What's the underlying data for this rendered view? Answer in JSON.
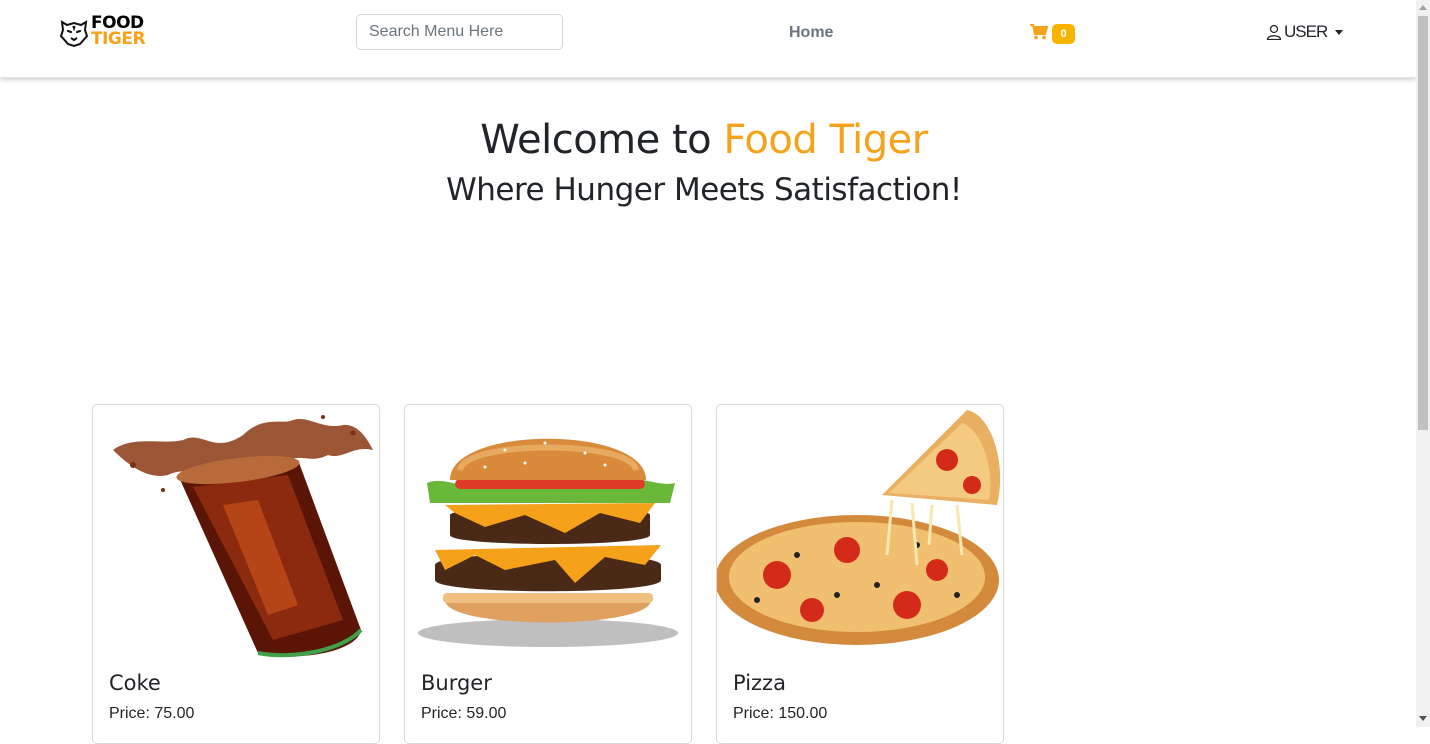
{
  "brand": {
    "line1": "FOOD",
    "line2": "TIGER"
  },
  "search": {
    "placeholder": "Search Menu Here"
  },
  "nav": {
    "home": "Home",
    "cart_count": "0",
    "user": "USER"
  },
  "hero": {
    "title_prefix": "Welcome to ",
    "title_accent": "Food Tiger",
    "subtitle": "Where Hunger Meets Satisfaction!"
  },
  "menu": [
    {
      "name": "Coke",
      "price": "Price: 75.00",
      "image": "coke-glass-splash"
    },
    {
      "name": "Burger",
      "price": "Price: 59.00",
      "image": "double-cheeseburger"
    },
    {
      "name": "Pizza",
      "price": "Price: 150.00",
      "image": "pepperoni-pizza"
    }
  ],
  "colors": {
    "accent": "#f7a21b",
    "badge": "#f7b500",
    "text": "#212529",
    "muted": "#6c757d"
  }
}
